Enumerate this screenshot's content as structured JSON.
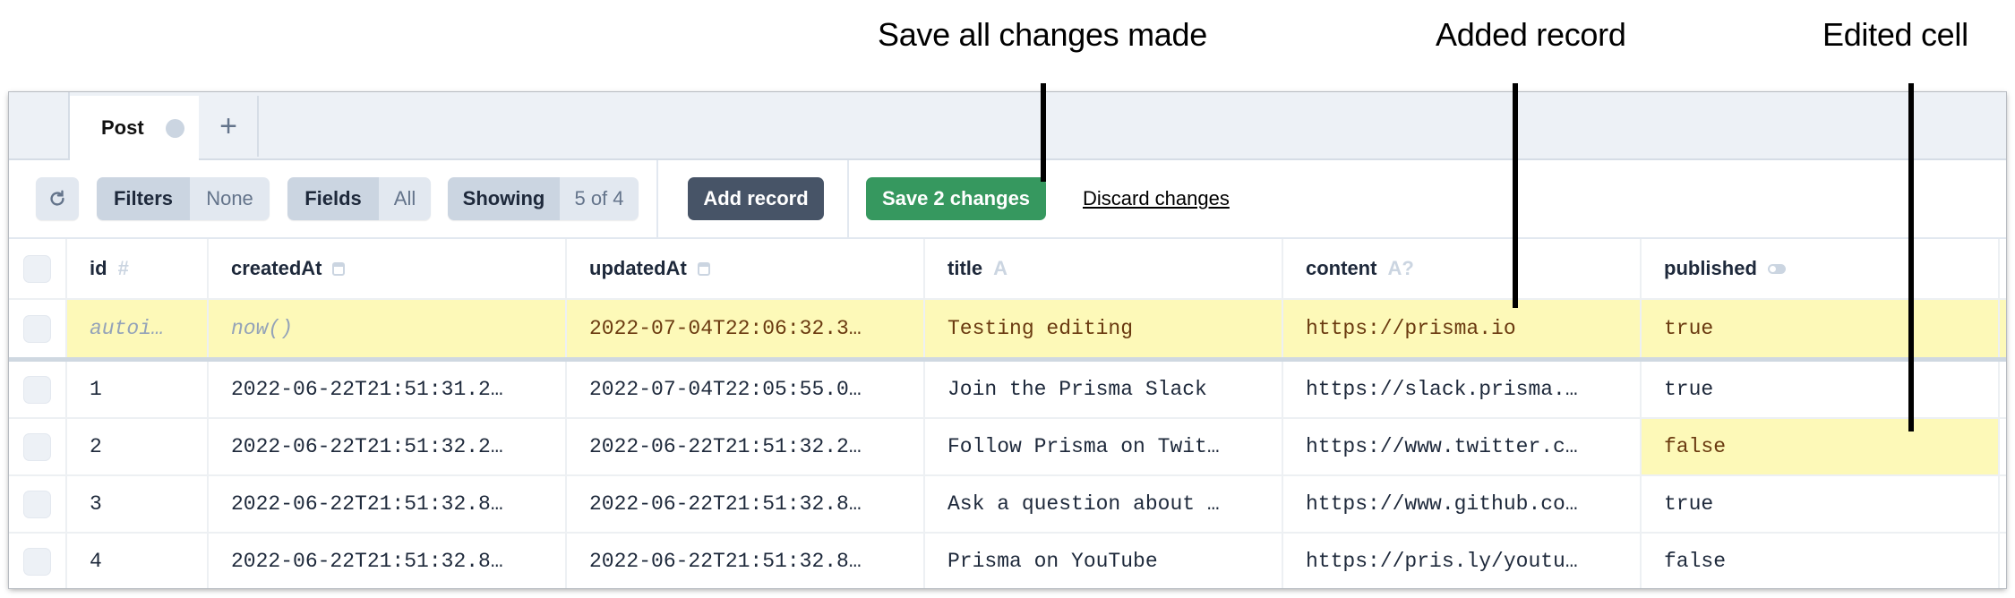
{
  "annotations": [
    {
      "label": "Save all changes made"
    },
    {
      "label": "Added record"
    },
    {
      "label": "Edited cell"
    }
  ],
  "tabs": [
    {
      "label": "Post",
      "status_dot_color": "#cbd5e1"
    }
  ],
  "add_tab_label": "+",
  "toolbar": {
    "refresh_icon": "refresh-icon",
    "filters_label": "Filters",
    "filters_value": "None",
    "fields_label": "Fields",
    "fields_value": "All",
    "showing_label": "Showing",
    "showing_value": "5 of 4",
    "add_record_label": "Add record",
    "save_label": "Save 2 changes",
    "discard_label": "Discard changes",
    "save_color": "#36985f",
    "add_color": "#475467"
  },
  "columns": [
    {
      "name": "id",
      "type_icon": "#"
    },
    {
      "name": "createdAt",
      "type_icon": "calendar-icon"
    },
    {
      "name": "updatedAt",
      "type_icon": "calendar-icon"
    },
    {
      "name": "title",
      "type_icon": "A"
    },
    {
      "name": "content",
      "type_icon": "A?"
    },
    {
      "name": "published",
      "type_icon": "toggle-icon"
    }
  ],
  "new_record": {
    "id": "autoi…",
    "createdAt": "now()",
    "updatedAt": "2022-07-04T22:06:32.3…",
    "title": "Testing editing",
    "content": "https://prisma.io",
    "published": "true"
  },
  "rows": [
    {
      "id": "1",
      "createdAt": "2022-06-22T21:51:31.2…",
      "updatedAt": "2022-07-04T22:05:55.0…",
      "title": "Join the Prisma Slack",
      "content": "https://slack.prisma.…",
      "published": "true"
    },
    {
      "id": "2",
      "createdAt": "2022-06-22T21:51:32.2…",
      "updatedAt": "2022-06-22T21:51:32.2…",
      "title": "Follow Prisma on Twit…",
      "content": "https://www.twitter.c…",
      "published": "false",
      "edited": "published"
    },
    {
      "id": "3",
      "createdAt": "2022-06-22T21:51:32.8…",
      "updatedAt": "2022-06-22T21:51:32.8…",
      "title": "Ask a question about …",
      "content": "https://www.github.co…",
      "published": "true"
    },
    {
      "id": "4",
      "createdAt": "2022-06-22T21:51:32.8…",
      "updatedAt": "2022-06-22T21:51:32.8…",
      "title": "Prisma on YouTube",
      "content": "https://pris.ly/youtu…",
      "published": "false"
    }
  ],
  "colors": {
    "changed_highlight": "#fdf9b8",
    "changed_text": "#6a3a10"
  }
}
